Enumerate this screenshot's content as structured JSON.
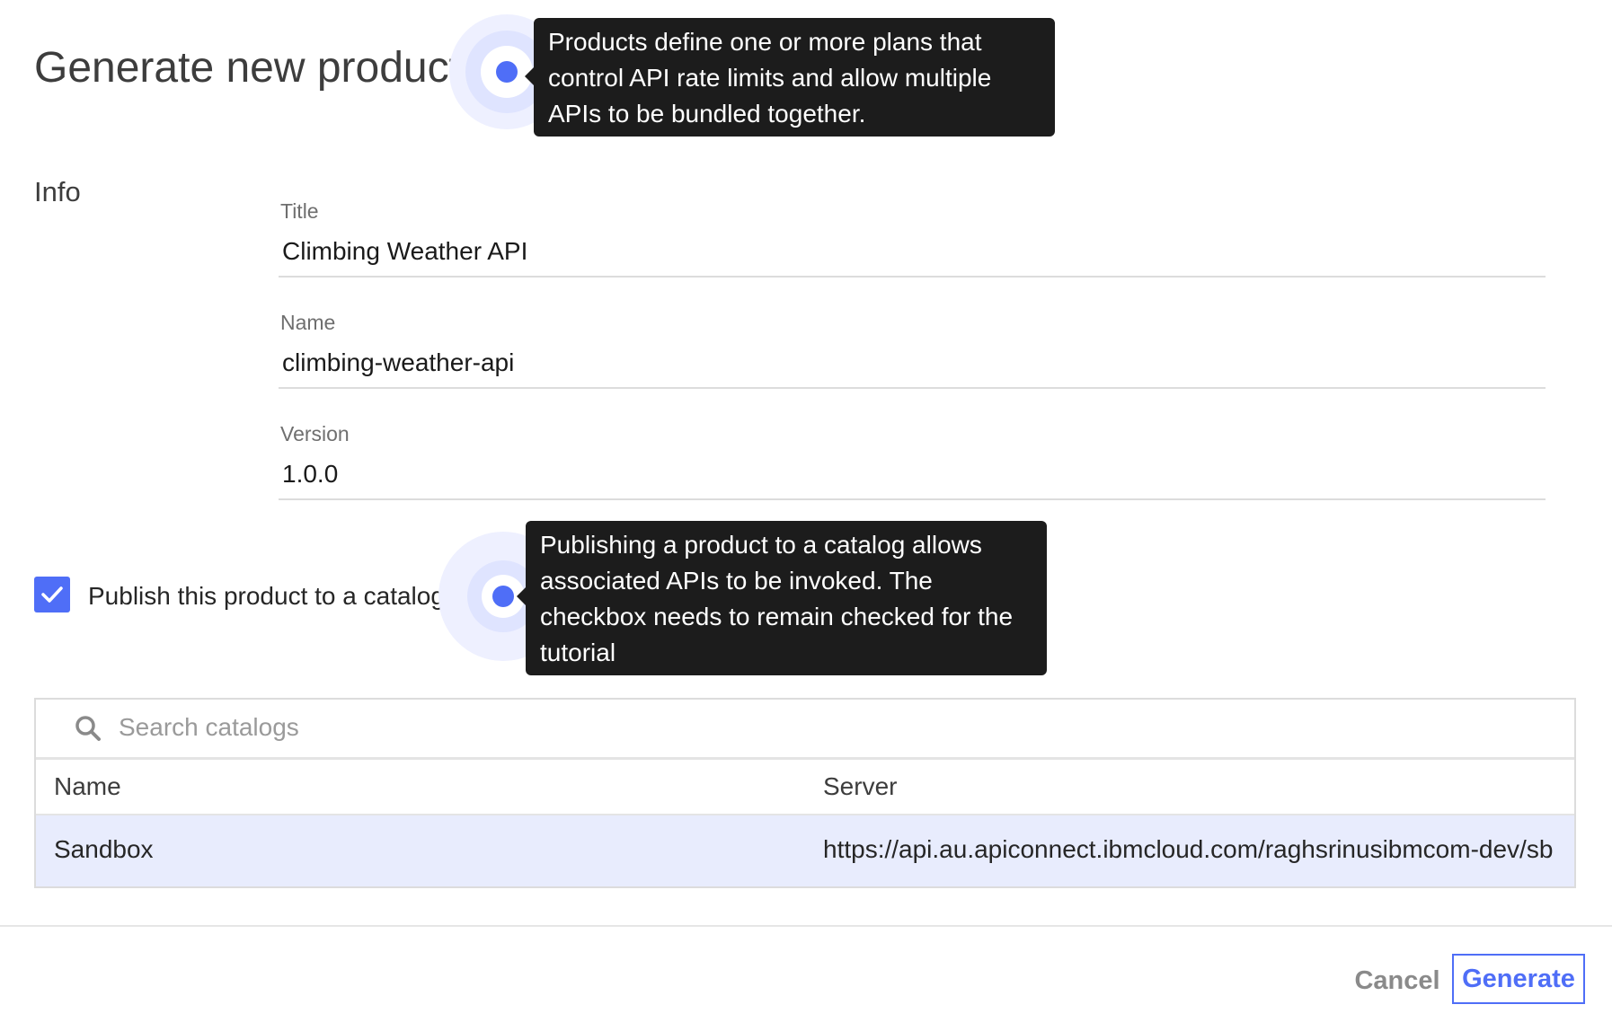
{
  "page": {
    "title": "Generate new product"
  },
  "info": {
    "section_label": "Info",
    "fields": {
      "title": {
        "label": "Title",
        "value": "Climbing Weather API"
      },
      "name": {
        "label": "Name",
        "value": "climbing-weather-api"
      },
      "version": {
        "label": "Version",
        "value": "1.0.0"
      }
    }
  },
  "publish": {
    "checkbox_label": "Publish this product to a catalog",
    "checked": true
  },
  "tooltips": {
    "products": [
      "Products define one or more plans that",
      "control API rate limits and allow multiple",
      "APIs to be bundled together."
    ],
    "publish": [
      "Publishing a product to a catalog allows",
      "associated APIs to be invoked. The",
      "checkbox needs to remain checked for the",
      "tutorial"
    ]
  },
  "catalogs": {
    "search_placeholder": "Search catalogs",
    "columns": {
      "name": "Name",
      "server": "Server"
    },
    "rows": [
      {
        "name": "Sandbox",
        "server": "https://api.au.apiconnect.ibmcloud.com/raghsrinusibmcom-dev/sb"
      }
    ]
  },
  "actions": {
    "cancel": "Cancel",
    "generate": "Generate"
  },
  "colors": {
    "accent": "#4f6ef7",
    "tooltip_bg": "#1c1c1c",
    "selected_row": "#e8ecfd"
  },
  "icons": {
    "search": "search-icon",
    "check": "checkmark-icon",
    "hotspot": "hotspot-icon"
  }
}
